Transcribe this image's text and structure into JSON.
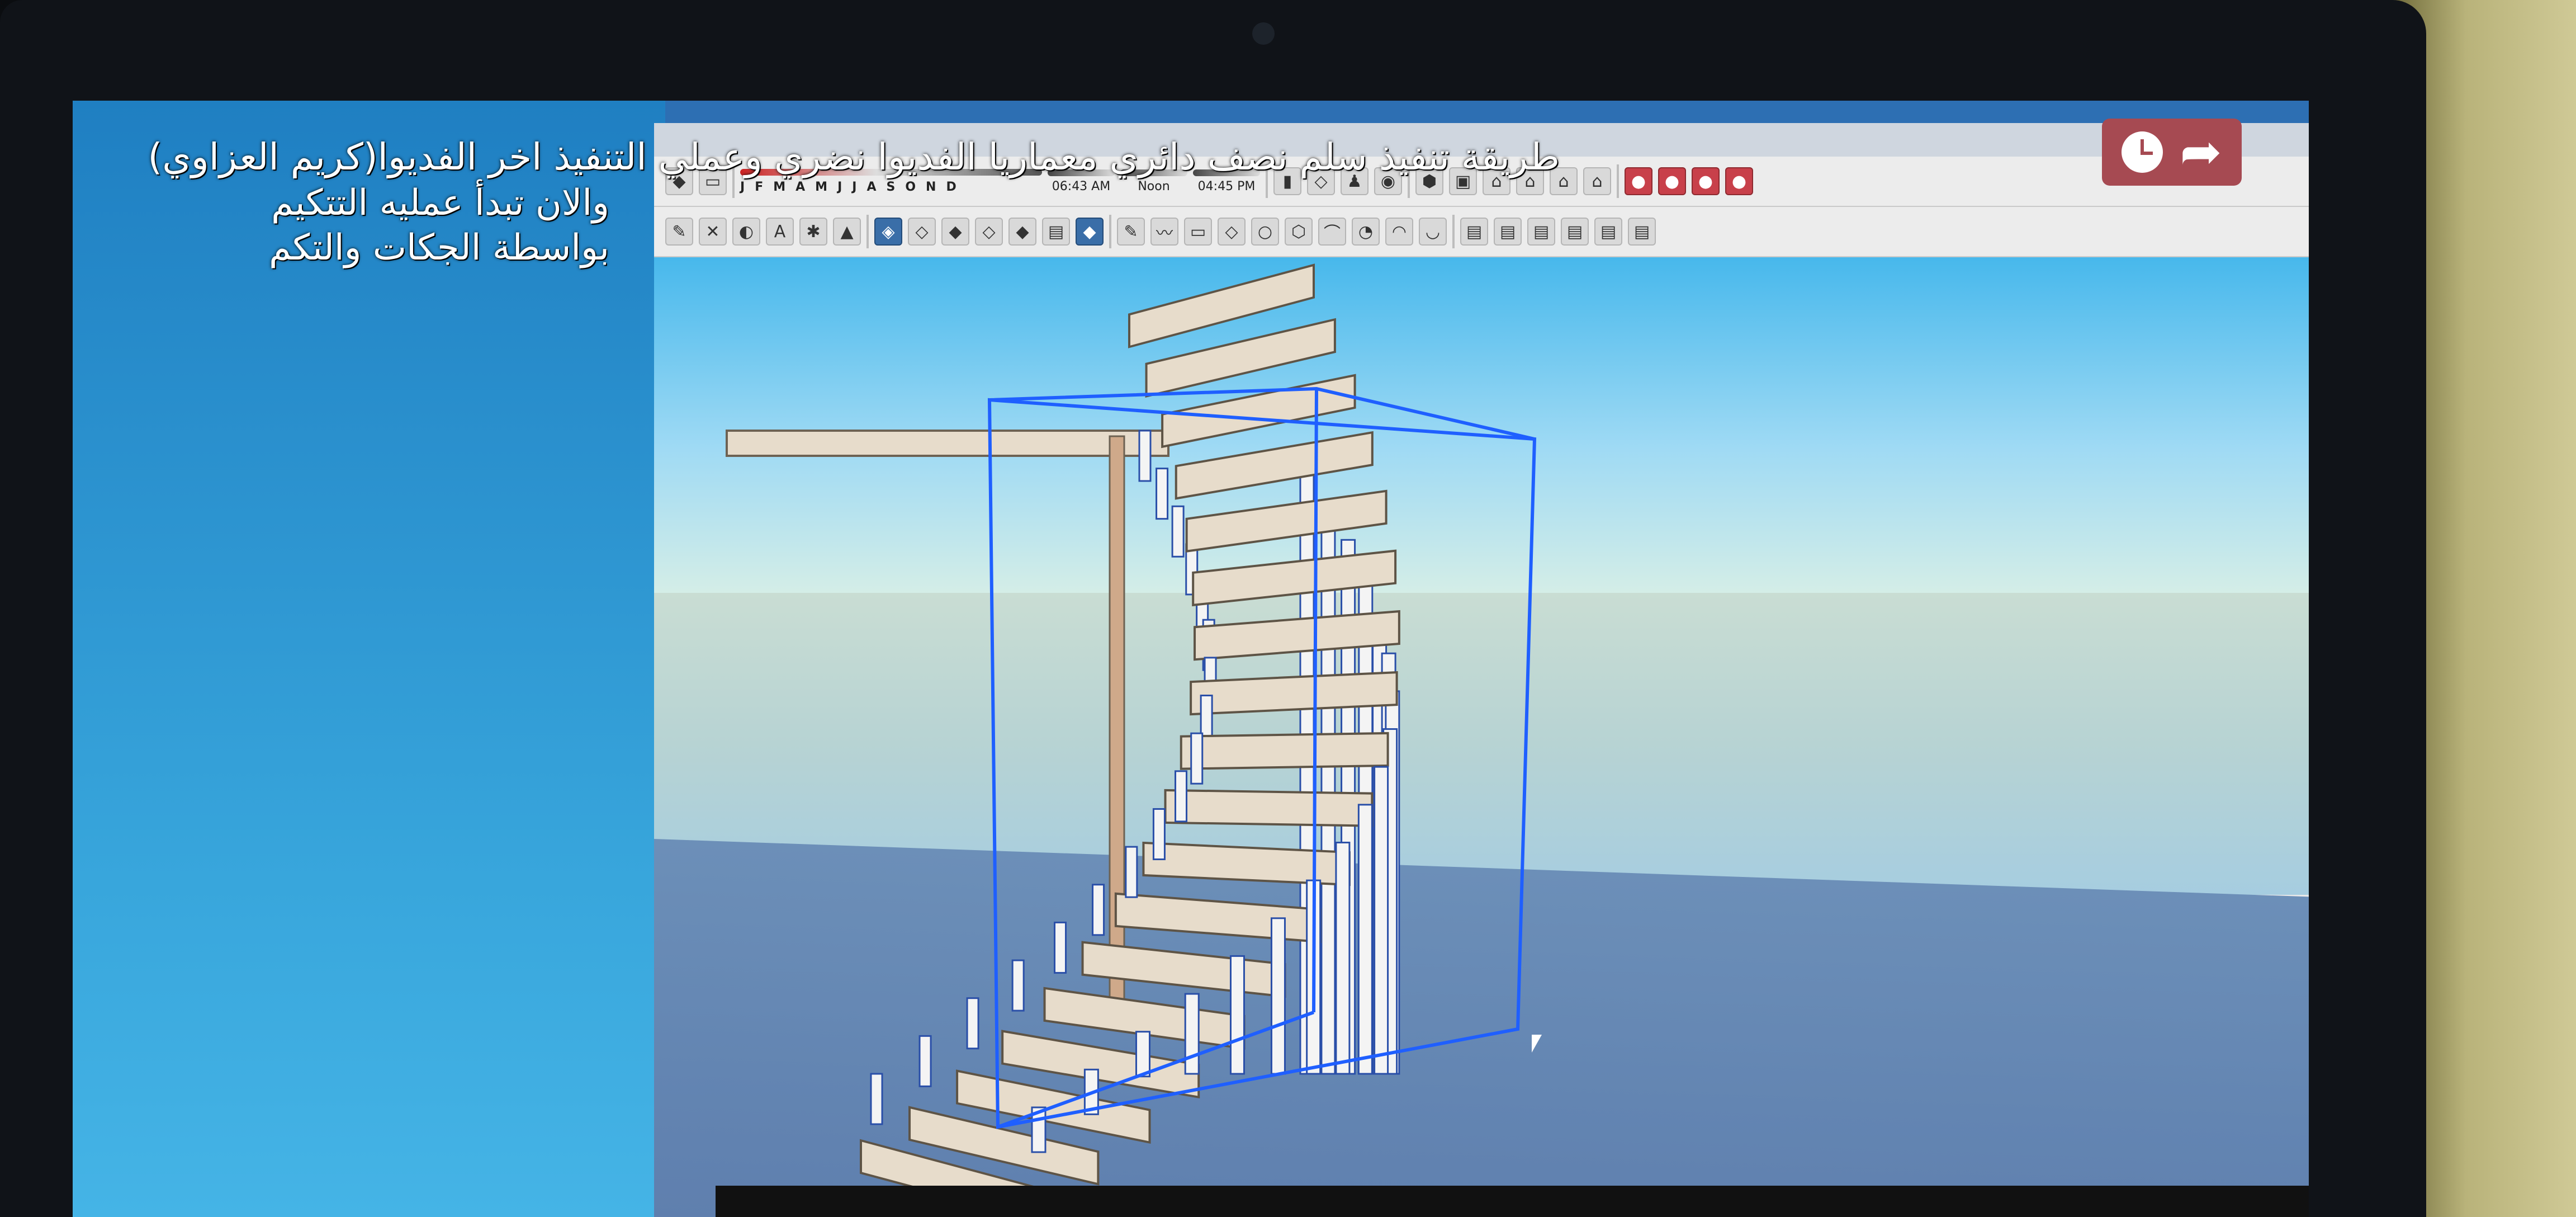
{
  "overlay": {
    "title_line_1": "طريقة تنفيذ سلم نصف دائري معماريا الفديوا نضري وعملي التنفيذ اخر الفديوا(كريم العزاوي)",
    "title_line_2": "والان تبدأ عمليه التتكيم",
    "title_line_3": "بواسطة الجكات والتكم"
  },
  "shadow_settings": {
    "months": [
      "J",
      "F",
      "M",
      "A",
      "M",
      "J",
      "J",
      "A",
      "S",
      "O",
      "N",
      "D"
    ],
    "time_start": "06:43 AM",
    "time_mid": "Noon",
    "time_end": "04:45 PM"
  },
  "icons": {
    "clock": "clock-icon",
    "share": "share-arrow-icon"
  },
  "colors": {
    "selection_box": "#1f5fff",
    "sky": "#47b8ec",
    "ground": "#6385b2",
    "wood": "#e7dccb"
  },
  "model": {
    "steps": 18
  }
}
